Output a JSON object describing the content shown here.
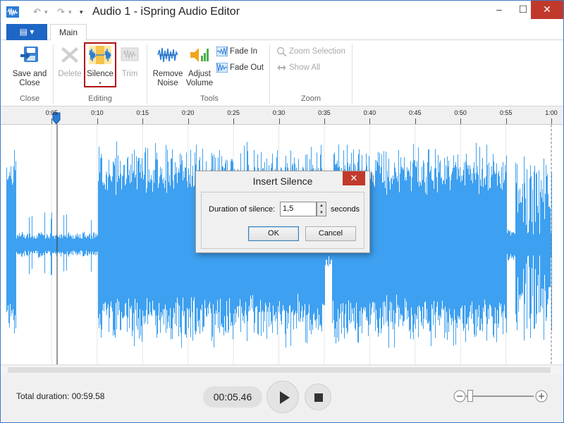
{
  "window": {
    "title": "Audio 1 - iSpring Audio Editor"
  },
  "ribbon": {
    "tab_main": "Main",
    "groups": {
      "close": "Close",
      "editing": "Editing",
      "tools": "Tools",
      "zoom": "Zoom"
    },
    "buttons": {
      "save_close_1": "Save and",
      "save_close_2": "Close",
      "delete": "Delete",
      "silence": "Silence",
      "trim": "Trim",
      "remove_noise_1": "Remove",
      "remove_noise_2": "Noise",
      "adjust_volume_1": "Adjust",
      "adjust_volume_2": "Volume",
      "fade_in": "Fade In",
      "fade_out": "Fade Out",
      "zoom_selection": "Zoom Selection",
      "show_all": "Show All"
    }
  },
  "timeline": {
    "ticks": [
      "0:05",
      "0:10",
      "0:15",
      "0:20",
      "0:25",
      "0:30",
      "0:35",
      "0:40",
      "0:45",
      "0:50",
      "0:55",
      "1:00"
    ]
  },
  "status": {
    "total_duration": "Total duration: 00:59.58",
    "current_time": "00:05.46"
  },
  "dialog": {
    "title": "Insert Silence",
    "label": "Duration of silence:",
    "value": "1,5",
    "unit": "seconds",
    "ok": "OK",
    "cancel": "Cancel"
  },
  "colors": {
    "waveform": "#3ea0f0",
    "accent": "#1e66c4",
    "close": "#c1392b"
  }
}
